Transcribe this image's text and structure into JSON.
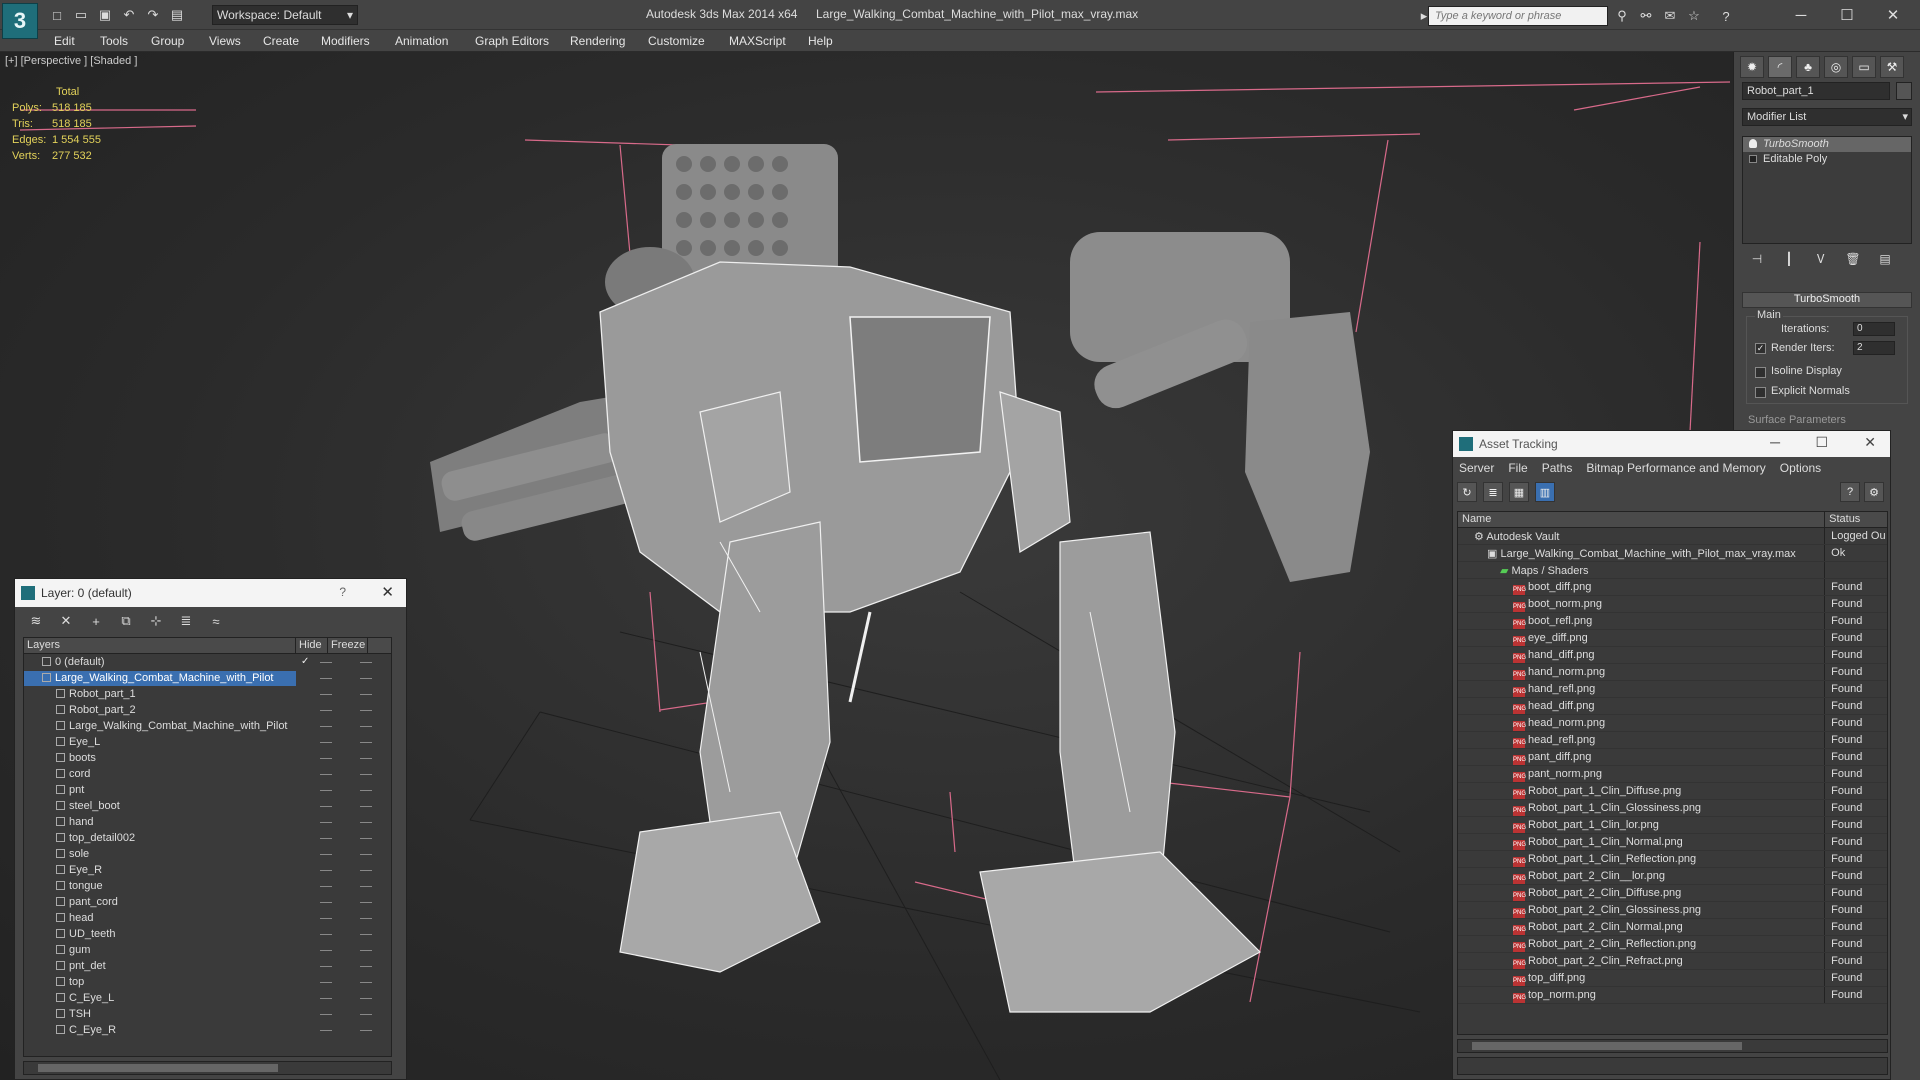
{
  "app": {
    "product": "Autodesk 3ds Max  2014 x64",
    "file": "Large_Walking_Combat_Machine_with_Pilot_max_vray.max",
    "workspace": "Workspace: Default",
    "search_placeholder": "Type a keyword or phrase"
  },
  "menu": [
    "Edit",
    "Tools",
    "Group",
    "Views",
    "Create",
    "Modifiers",
    "Animation",
    "Graph Editors",
    "Rendering",
    "Customize",
    "MAXScript",
    "Help"
  ],
  "viewport": {
    "label": "[+] [Perspective ] [Shaded ]",
    "stats": {
      "header": "Total",
      "rows": [
        {
          "label": "Polys:",
          "value": "518 185"
        },
        {
          "label": "Tris:",
          "value": "518 185"
        },
        {
          "label": "Edges:",
          "value": "1 554 555"
        },
        {
          "label": "Verts:",
          "value": "277 532"
        }
      ]
    }
  },
  "command_panel": {
    "object_name": "Robot_part_1",
    "modifier_list": "Modifier List",
    "stack": [
      "TurboSmooth",
      "Editable Poly"
    ],
    "rollout": "TurboSmooth",
    "group": "Main",
    "iterations_label": "Iterations:",
    "iterations_value": "0",
    "render_iters_label": "Render Iters:",
    "render_iters_value": "2",
    "isoline_label": "Isoline Display",
    "explicit_label": "Explicit Normals",
    "surface_label": "Surface Parameters"
  },
  "layer_window": {
    "title": "Layer: 0 (default)",
    "columns": {
      "layers": "Layers",
      "hide": "Hide",
      "freeze": "Freeze"
    },
    "rows": [
      {
        "name": "0 (default)",
        "indent": 1,
        "type": "layer"
      },
      {
        "name": "Large_Walking_Combat_Machine_with_Pilot",
        "indent": 1,
        "type": "layer",
        "selected": true
      },
      {
        "name": "Robot_part_1",
        "indent": 2,
        "type": "obj"
      },
      {
        "name": "Robot_part_2",
        "indent": 2,
        "type": "obj"
      },
      {
        "name": "Large_Walking_Combat_Machine_with_Pilot",
        "indent": 2,
        "type": "obj"
      },
      {
        "name": "Eye_L",
        "indent": 2,
        "type": "obj"
      },
      {
        "name": "boots",
        "indent": 2,
        "type": "obj"
      },
      {
        "name": "cord",
        "indent": 2,
        "type": "obj"
      },
      {
        "name": "pnt",
        "indent": 2,
        "type": "obj"
      },
      {
        "name": "steel_boot",
        "indent": 2,
        "type": "obj"
      },
      {
        "name": "hand",
        "indent": 2,
        "type": "obj"
      },
      {
        "name": "top_detail002",
        "indent": 2,
        "type": "obj"
      },
      {
        "name": "sole",
        "indent": 2,
        "type": "obj"
      },
      {
        "name": "Eye_R",
        "indent": 2,
        "type": "obj"
      },
      {
        "name": "tongue",
        "indent": 2,
        "type": "obj"
      },
      {
        "name": "pant_cord",
        "indent": 2,
        "type": "obj"
      },
      {
        "name": "head",
        "indent": 2,
        "type": "obj"
      },
      {
        "name": "UD_teeth",
        "indent": 2,
        "type": "obj"
      },
      {
        "name": "gum",
        "indent": 2,
        "type": "obj"
      },
      {
        "name": "pnt_det",
        "indent": 2,
        "type": "obj"
      },
      {
        "name": "top",
        "indent": 2,
        "type": "obj"
      },
      {
        "name": "C_Eye_L",
        "indent": 2,
        "type": "obj"
      },
      {
        "name": "TSH",
        "indent": 2,
        "type": "obj"
      },
      {
        "name": "C_Eye_R",
        "indent": 2,
        "type": "obj"
      }
    ]
  },
  "asset_window": {
    "title": "Asset Tracking",
    "menu": [
      "Server",
      "File",
      "Paths",
      "Bitmap Performance and Memory",
      "Options"
    ],
    "columns": {
      "name": "Name",
      "status": "Status"
    },
    "rows": [
      {
        "name": "Autodesk Vault",
        "status": "Logged Ou",
        "level": 0,
        "icon": "vault"
      },
      {
        "name": "Large_Walking_Combat_Machine_with_Pilot_max_vray.max",
        "status": "Ok",
        "level": 1,
        "icon": "max"
      },
      {
        "name": "Maps / Shaders",
        "status": "",
        "level": 2,
        "icon": "maps"
      },
      {
        "name": "boot_diff.png",
        "status": "Found",
        "level": 3,
        "icon": "png"
      },
      {
        "name": "boot_norm.png",
        "status": "Found",
        "level": 3,
        "icon": "png"
      },
      {
        "name": "boot_refl.png",
        "status": "Found",
        "level": 3,
        "icon": "png"
      },
      {
        "name": "eye_diff.png",
        "status": "Found",
        "level": 3,
        "icon": "png"
      },
      {
        "name": "hand_diff.png",
        "status": "Found",
        "level": 3,
        "icon": "png"
      },
      {
        "name": "hand_norm.png",
        "status": "Found",
        "level": 3,
        "icon": "png"
      },
      {
        "name": "hand_refl.png",
        "status": "Found",
        "level": 3,
        "icon": "png"
      },
      {
        "name": "head_diff.png",
        "status": "Found",
        "level": 3,
        "icon": "png"
      },
      {
        "name": "head_norm.png",
        "status": "Found",
        "level": 3,
        "icon": "png"
      },
      {
        "name": "head_refl.png",
        "status": "Found",
        "level": 3,
        "icon": "png"
      },
      {
        "name": "pant_diff.png",
        "status": "Found",
        "level": 3,
        "icon": "png"
      },
      {
        "name": "pant_norm.png",
        "status": "Found",
        "level": 3,
        "icon": "png"
      },
      {
        "name": "Robot_part_1_Clin_Diffuse.png",
        "status": "Found",
        "level": 3,
        "icon": "png"
      },
      {
        "name": "Robot_part_1_Clin_Glossiness.png",
        "status": "Found",
        "level": 3,
        "icon": "png"
      },
      {
        "name": "Robot_part_1_Clin_lor.png",
        "status": "Found",
        "level": 3,
        "icon": "png"
      },
      {
        "name": "Robot_part_1_Clin_Normal.png",
        "status": "Found",
        "level": 3,
        "icon": "png"
      },
      {
        "name": "Robot_part_1_Clin_Reflection.png",
        "status": "Found",
        "level": 3,
        "icon": "png"
      },
      {
        "name": "Robot_part_2_Clin__lor.png",
        "status": "Found",
        "level": 3,
        "icon": "png"
      },
      {
        "name": "Robot_part_2_Clin_Diffuse.png",
        "status": "Found",
        "level": 3,
        "icon": "png"
      },
      {
        "name": "Robot_part_2_Clin_Glossiness.png",
        "status": "Found",
        "level": 3,
        "icon": "png"
      },
      {
        "name": "Robot_part_2_Clin_Normal.png",
        "status": "Found",
        "level": 3,
        "icon": "png"
      },
      {
        "name": "Robot_part_2_Clin_Reflection.png",
        "status": "Found",
        "level": 3,
        "icon": "png"
      },
      {
        "name": "Robot_part_2_Clin_Refract.png",
        "status": "Found",
        "level": 3,
        "icon": "png"
      },
      {
        "name": "top_diff.png",
        "status": "Found",
        "level": 3,
        "icon": "png"
      },
      {
        "name": "top_norm.png",
        "status": "Found",
        "level": 3,
        "icon": "png"
      }
    ]
  }
}
